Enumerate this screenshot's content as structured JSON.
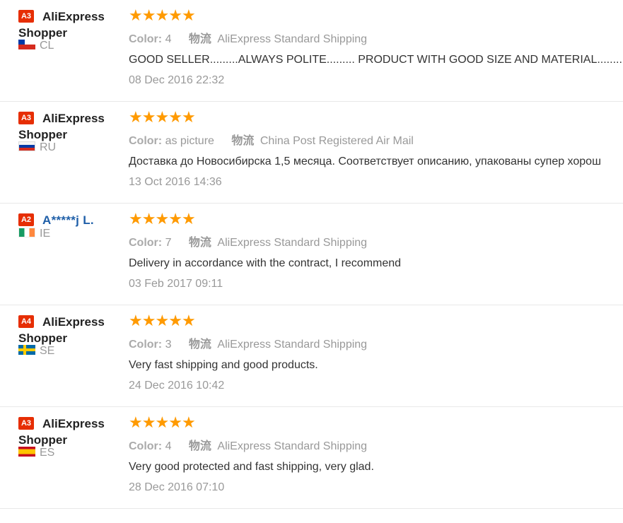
{
  "reviews": [
    {
      "badge": "A3",
      "name_line1": "AliExpress",
      "name_line2": "Shopper",
      "country": "CL",
      "color_label": "Color:",
      "color_value": "4",
      "shipping_label": "物流",
      "shipping_value": "AliExpress Standard Shipping",
      "text": "GOOD SELLER.........ALWAYS POLITE......... PRODUCT WITH GOOD SIZE AND MATERIAL...........",
      "date": "08 Dec 2016 22:32",
      "rating": 5
    },
    {
      "badge": "A3",
      "name_line1": "AliExpress",
      "name_line2": "Shopper",
      "country": "RU",
      "color_label": "Color:",
      "color_value": "as picture",
      "shipping_label": "物流",
      "shipping_value": "China Post Registered Air Mail",
      "text": "Доставка до Новосибирска 1,5 месяца. Соответствует описанию, упакованы супер хорош",
      "date": "13 Oct 2016 14:36",
      "rating": 5
    },
    {
      "badge": "A2",
      "name_line1": "A*****j L.",
      "name_line2": "",
      "country": "IE",
      "color_label": "Color:",
      "color_value": "7",
      "shipping_label": "物流",
      "shipping_value": "AliExpress Standard Shipping",
      "text": "Delivery in accordance with the contract, I recommend",
      "date": "03 Feb 2017 09:11",
      "rating": 5
    },
    {
      "badge": "A4",
      "name_line1": "AliExpress",
      "name_line2": "Shopper",
      "country": "SE",
      "color_label": "Color:",
      "color_value": "3",
      "shipping_label": "物流",
      "shipping_value": "AliExpress Standard Shipping",
      "text": "Very fast shipping and good products.",
      "date": "24 Dec 2016 10:42",
      "rating": 5
    },
    {
      "badge": "A3",
      "name_line1": "AliExpress",
      "name_line2": "Shopper",
      "country": "ES",
      "color_label": "Color:",
      "color_value": "4",
      "shipping_label": "物流",
      "shipping_value": "AliExpress Standard Shipping",
      "text": "Very good protected and fast shipping, very glad.",
      "date": "28 Dec 2016 07:10",
      "rating": 5
    }
  ],
  "colors": {
    "star": "#ff9a00",
    "badge": "#e62e04",
    "link": "#1f5fa8"
  }
}
